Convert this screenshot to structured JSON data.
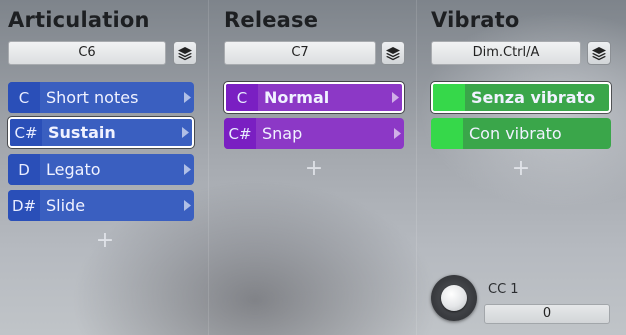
{
  "columns": [
    {
      "title": "Articulation",
      "preset": "C6",
      "slots": [
        {
          "key": "C",
          "label": "Short notes"
        },
        {
          "key": "C#",
          "label": "Sustain"
        },
        {
          "key": "D",
          "label": "Legato"
        },
        {
          "key": "D#",
          "label": "Slide"
        }
      ],
      "add_symbol": "+"
    },
    {
      "title": "Release",
      "preset": "C7",
      "slots": [
        {
          "key": "C",
          "label": "Normal"
        },
        {
          "key": "C#",
          "label": "Snap"
        }
      ],
      "add_symbol": "+"
    },
    {
      "title": "Vibrato",
      "preset": "Dim.Ctrl/A",
      "slots": [
        {
          "label": "Senza vibrato"
        },
        {
          "label": "Con vibrato"
        }
      ],
      "add_symbol": "+",
      "controller": {
        "label": "CC 1",
        "value": "0"
      }
    }
  ],
  "colors": {
    "articulation": "#3a5fc0",
    "release": "#8c38c6",
    "vibrato": "#3aa64a",
    "selected_border": "#ffffff"
  },
  "selected": {
    "articulation": 1,
    "release": 0,
    "vibrato": 0
  },
  "icons": {
    "layers": "layers-icon",
    "arrow": "chevron-right-icon",
    "add": "plus-icon"
  }
}
